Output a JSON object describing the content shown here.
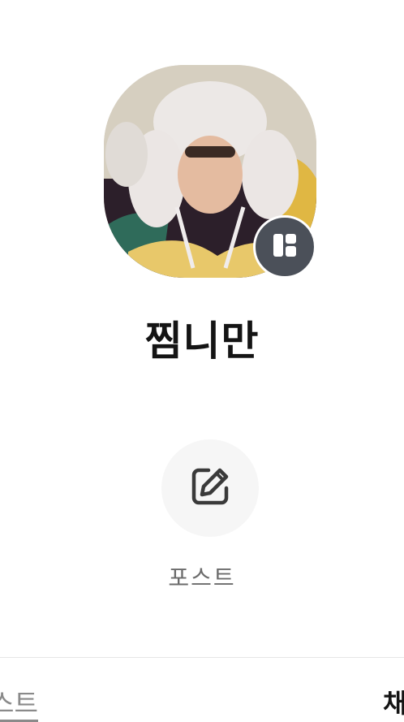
{
  "profile": {
    "name": "찜니만",
    "photo_alt": "profile-photo",
    "badge_icon": "layout-icon"
  },
  "actions": {
    "post_label": "포스트",
    "post_icon": "edit-icon"
  },
  "tabs": [
    {
      "label": "스트",
      "active": false
    },
    {
      "label": "채",
      "active": true
    }
  ],
  "colors": {
    "badge_bg": "#4b5059",
    "action_circle_bg": "#f6f6f6",
    "name_text": "#141414",
    "muted_text": "#6b6b6b"
  }
}
